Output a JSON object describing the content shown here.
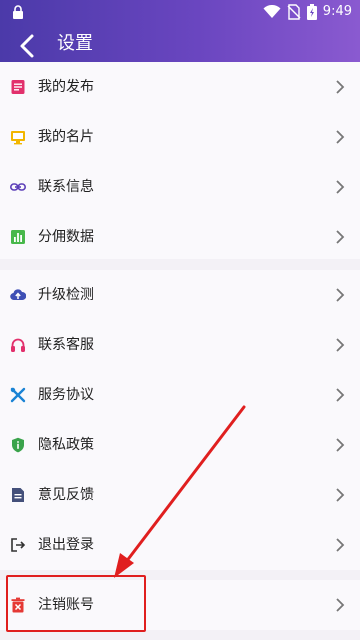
{
  "status_bar": {
    "time": "9:49"
  },
  "header": {
    "title": "设置"
  },
  "groups": [
    {
      "items": [
        {
          "label": "我的发布",
          "icon": "document-icon",
          "color": "#e2306c"
        },
        {
          "label": "我的名片",
          "icon": "card-icon",
          "color": "#f2b600"
        },
        {
          "label": "联系信息",
          "icon": "link-icon",
          "color": "#5c3fb8"
        },
        {
          "label": "分佣数据",
          "icon": "bar-chart-icon",
          "color": "#48b84b"
        }
      ]
    },
    {
      "items": [
        {
          "label": "升级检测",
          "icon": "cloud-upload-icon",
          "color": "#3e4fb5"
        },
        {
          "label": "联系客服",
          "icon": "headset-icon",
          "color": "#e2306c"
        },
        {
          "label": "服务协议",
          "icon": "tools-icon",
          "color": "#1a83d4"
        },
        {
          "label": "隐私政策",
          "icon": "shield-info-icon",
          "color": "#3aa34b"
        },
        {
          "label": "意见反馈",
          "icon": "feedback-doc-icon",
          "color": "#44507a"
        },
        {
          "label": "退出登录",
          "icon": "logout-icon",
          "color": "#333333"
        }
      ]
    },
    {
      "items": [
        {
          "label": "注销账号",
          "icon": "trash-icon",
          "color": "#e53935"
        }
      ]
    }
  ],
  "annotation": {
    "color": "#e01f1f"
  }
}
